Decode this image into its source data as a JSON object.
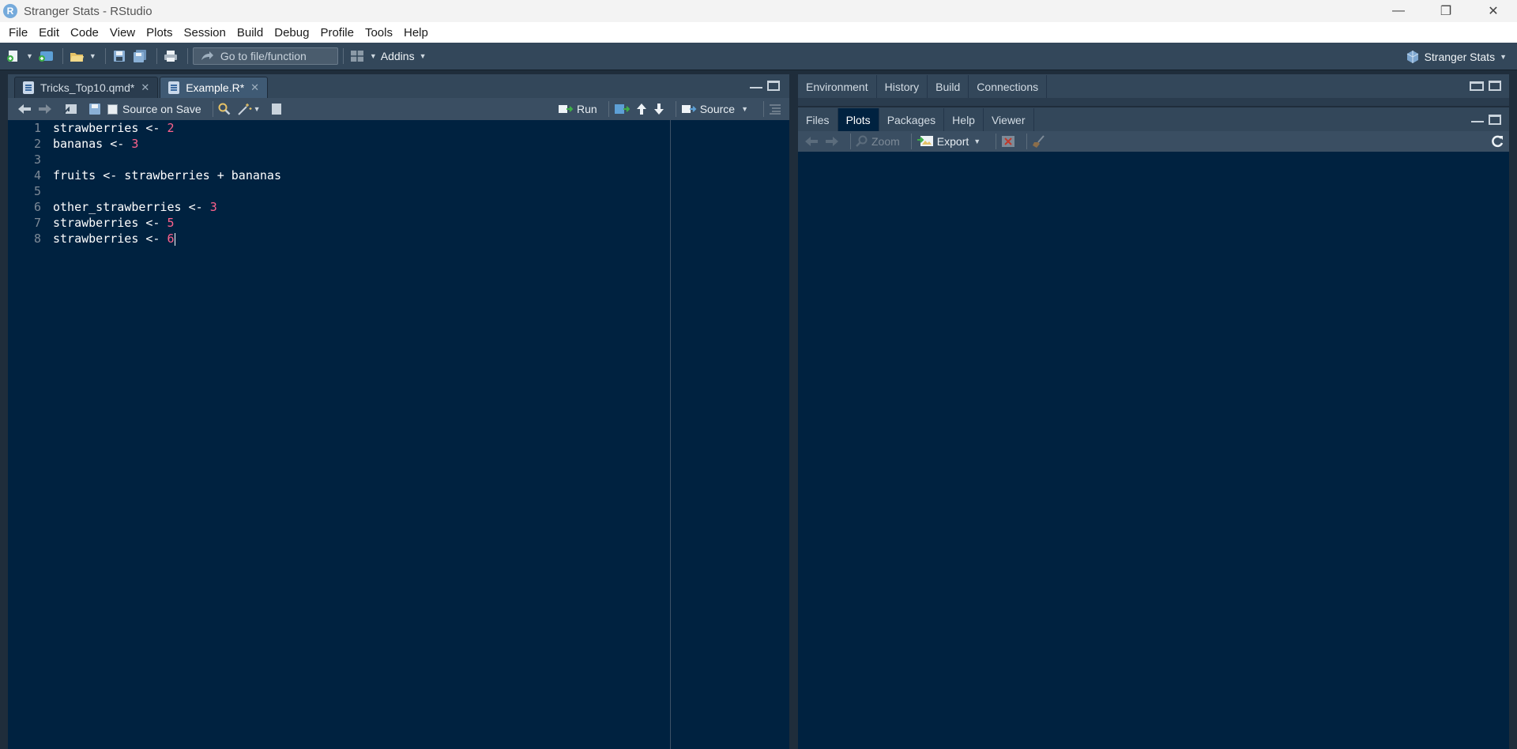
{
  "window": {
    "title": "Stranger Stats - RStudio",
    "logo_letter": "R"
  },
  "menu": [
    "File",
    "Edit",
    "Code",
    "View",
    "Plots",
    "Session",
    "Build",
    "Debug",
    "Profile",
    "Tools",
    "Help"
  ],
  "toolbar": {
    "goto_placeholder": "Go to file/function",
    "addins_label": "Addins",
    "project_name": "Stranger Stats"
  },
  "editor": {
    "tabs": [
      {
        "label": "Tricks_Top10.qmd*",
        "active": false
      },
      {
        "label": "Example.R*",
        "active": true
      }
    ],
    "source_on_save": "Source on Save",
    "run_label": "Run",
    "source_label": "Source",
    "lines": [
      {
        "n": "1",
        "code": "strawberries <- ",
        "num": "2"
      },
      {
        "n": "2",
        "code": "bananas <- ",
        "num": "3"
      },
      {
        "n": "3",
        "code": "",
        "num": ""
      },
      {
        "n": "4",
        "code": "fruits <- strawberries + bananas",
        "num": ""
      },
      {
        "n": "5",
        "code": "",
        "num": ""
      },
      {
        "n": "6",
        "code": "other_strawberries <- ",
        "num": "3"
      },
      {
        "n": "7",
        "code": "strawberries <- ",
        "num": "5"
      },
      {
        "n": "8",
        "code": "strawberries <- ",
        "num": "6"
      }
    ]
  },
  "top_right_tabs": [
    "Environment",
    "History",
    "Build",
    "Connections"
  ],
  "bottom_right_tabs": [
    {
      "label": "Files",
      "active": false
    },
    {
      "label": "Plots",
      "active": true
    },
    {
      "label": "Packages",
      "active": false
    },
    {
      "label": "Help",
      "active": false
    },
    {
      "label": "Viewer",
      "active": false
    }
  ],
  "plots_toolbar": {
    "zoom_label": "Zoom",
    "export_label": "Export"
  },
  "colors": {
    "editor_bg": "#002240",
    "number": "#ff628c",
    "toolbar": "#33475a"
  }
}
